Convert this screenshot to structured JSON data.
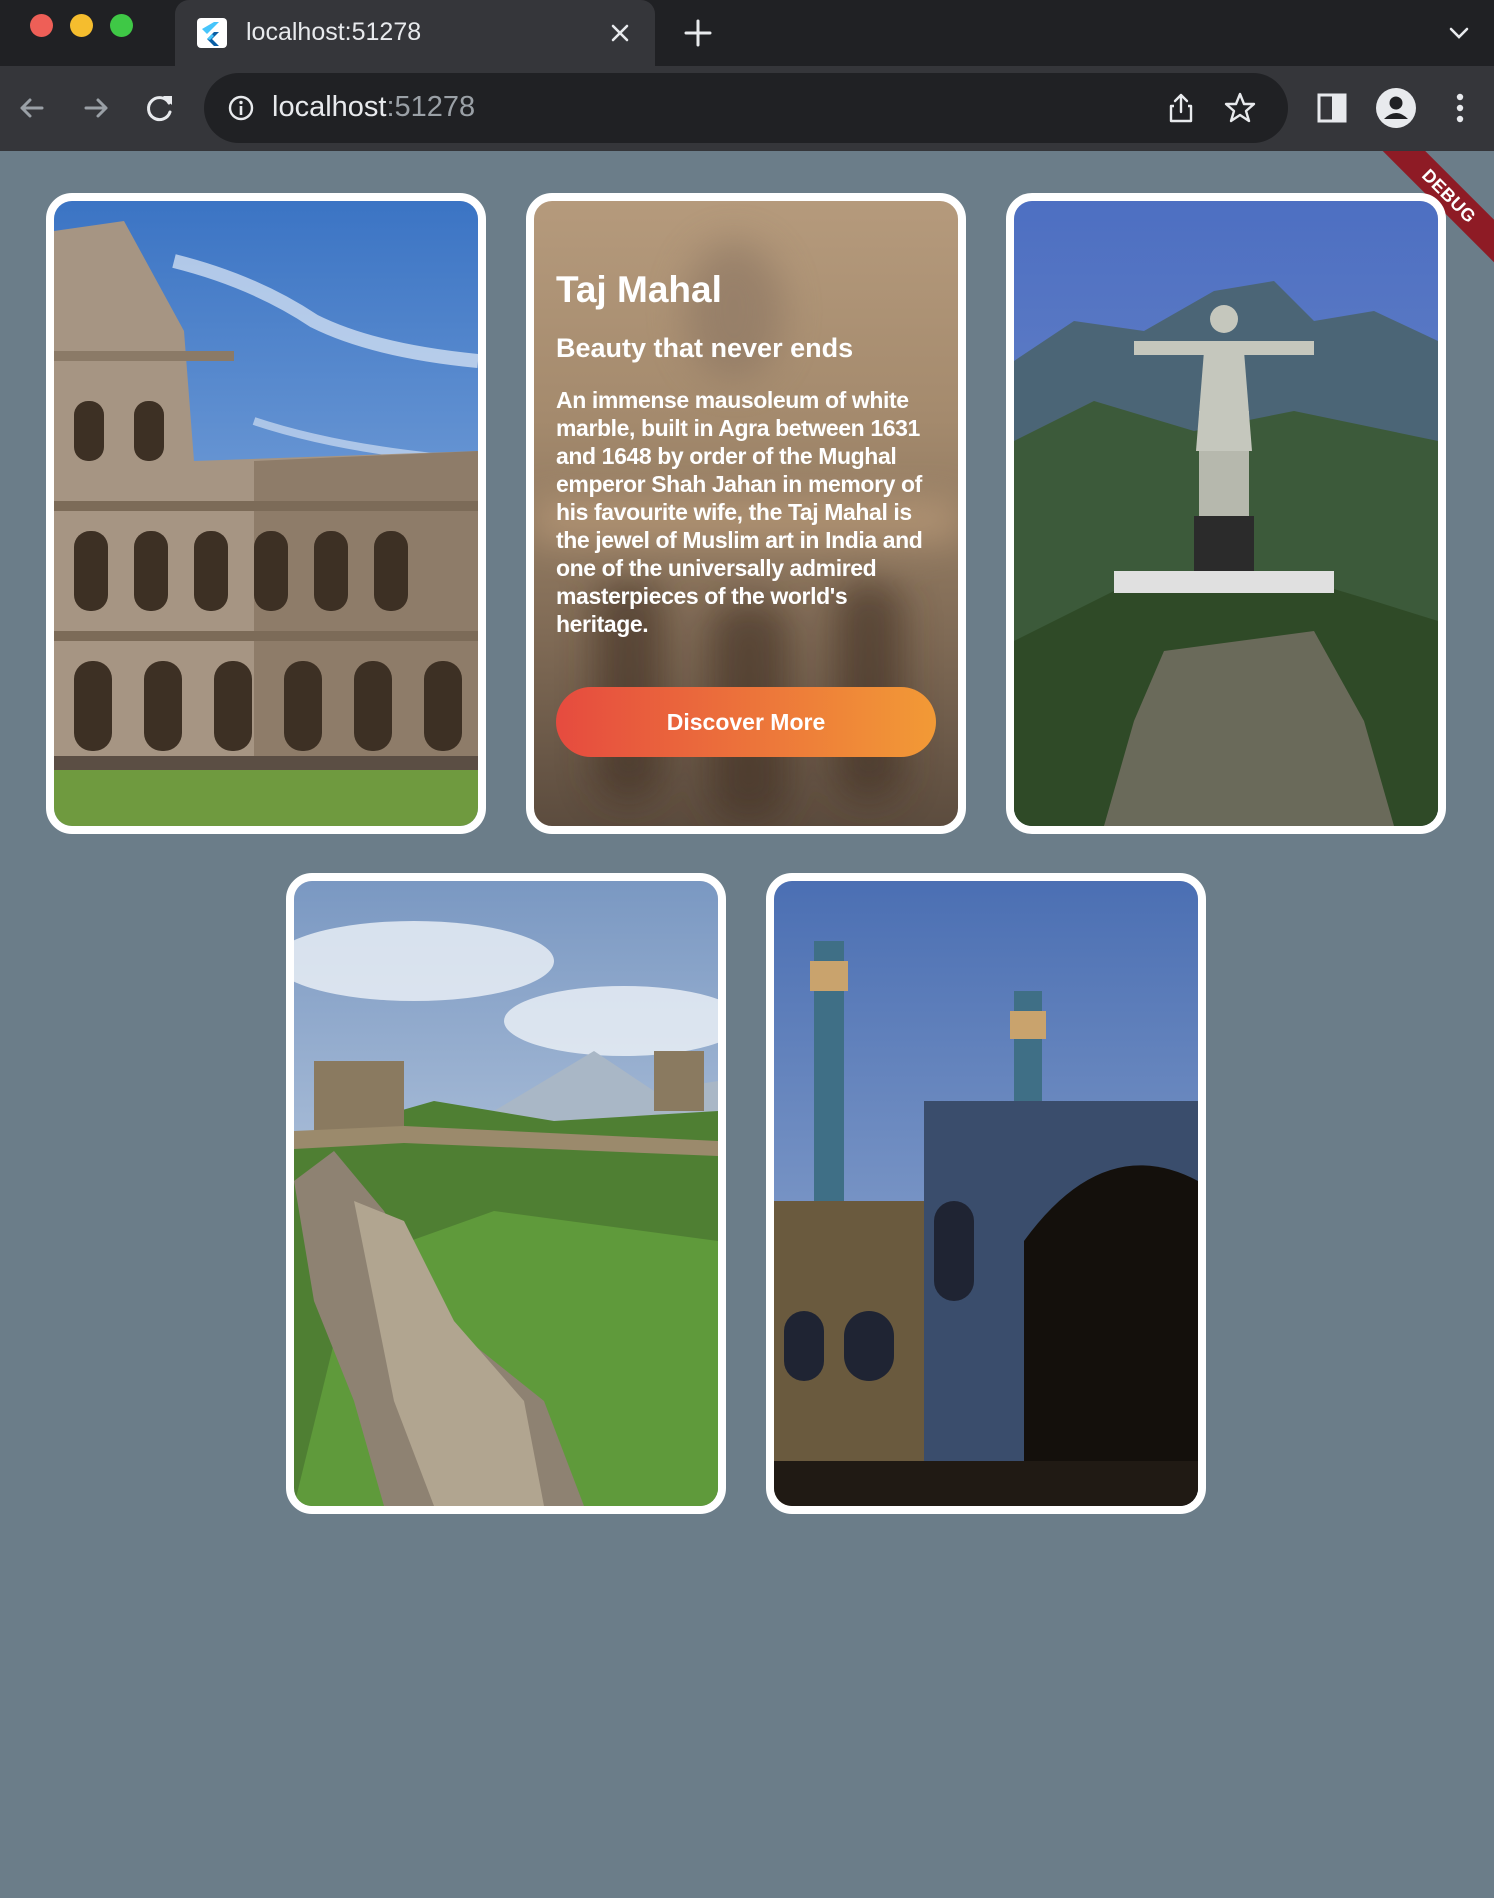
{
  "browser": {
    "tab_title": "localhost:51278",
    "url_host": "localhost",
    "url_port": ":51278"
  },
  "debug_banner": "DEBUG",
  "featured": {
    "title": "Taj Mahal",
    "subtitle": "Beauty that never ends",
    "description": "An immense mausoleum of white marble, built in Agra between 1631 and 1648 by order of the Mughal emperor Shah Jahan in memory of his favourite wife, the Taj Mahal is the jewel of Muslim art in India and one of the universally admired masterpieces of the world's heritage.",
    "button_label": "Discover More"
  },
  "colors": {
    "page_background": "#6b7d89",
    "card_border": "#ffffff",
    "button_start": "#e64b3f",
    "button_end": "#f29a36",
    "debug_banner": "#8e1b25"
  }
}
